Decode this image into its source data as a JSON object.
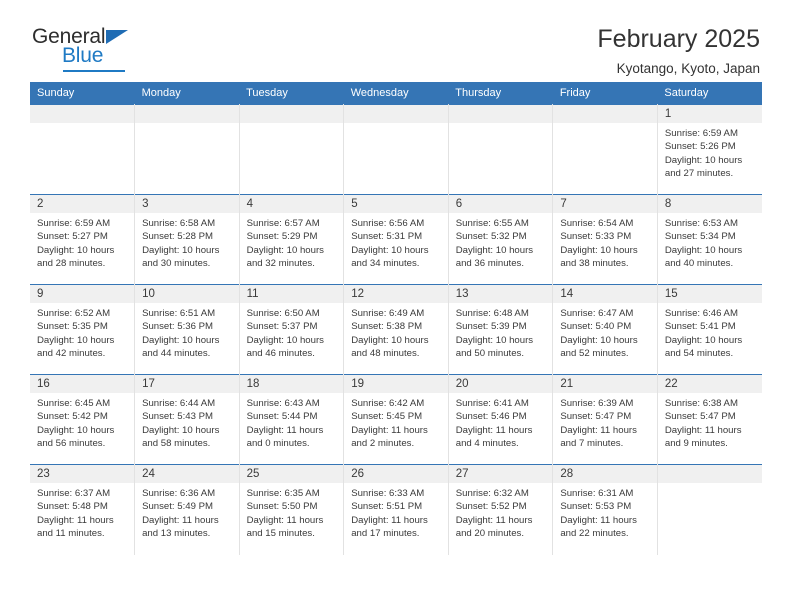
{
  "brand": {
    "name_part1": "General",
    "name_part2": "Blue",
    "triangle_icon": "triangle-icon"
  },
  "header": {
    "title": "February 2025",
    "subtitle": "Kyotango, Kyoto, Japan"
  },
  "colors": {
    "header_blue": "#3575b5",
    "brand_blue": "#1f7ac4",
    "daynum_band": "#f0f0f0",
    "text": "#3a3a3a"
  },
  "weekdays": [
    "Sunday",
    "Monday",
    "Tuesday",
    "Wednesday",
    "Thursday",
    "Friday",
    "Saturday"
  ],
  "labels": {
    "sunrise": "Sunrise:",
    "sunset": "Sunset:",
    "daylight": "Daylight:"
  },
  "weeks": [
    [
      {
        "day": "",
        "sunrise": "",
        "sunset": "",
        "daylight": "",
        "empty": true
      },
      {
        "day": "",
        "sunrise": "",
        "sunset": "",
        "daylight": "",
        "empty": true
      },
      {
        "day": "",
        "sunrise": "",
        "sunset": "",
        "daylight": "",
        "empty": true
      },
      {
        "day": "",
        "sunrise": "",
        "sunset": "",
        "daylight": "",
        "empty": true
      },
      {
        "day": "",
        "sunrise": "",
        "sunset": "",
        "daylight": "",
        "empty": true
      },
      {
        "day": "",
        "sunrise": "",
        "sunset": "",
        "daylight": "",
        "empty": true
      },
      {
        "day": "1",
        "sunrise": "Sunrise: 6:59 AM",
        "sunset": "Sunset: 5:26 PM",
        "daylight": "Daylight: 10 hours and 27 minutes.",
        "empty": false
      }
    ],
    [
      {
        "day": "2",
        "sunrise": "Sunrise: 6:59 AM",
        "sunset": "Sunset: 5:27 PM",
        "daylight": "Daylight: 10 hours and 28 minutes.",
        "empty": false
      },
      {
        "day": "3",
        "sunrise": "Sunrise: 6:58 AM",
        "sunset": "Sunset: 5:28 PM",
        "daylight": "Daylight: 10 hours and 30 minutes.",
        "empty": false
      },
      {
        "day": "4",
        "sunrise": "Sunrise: 6:57 AM",
        "sunset": "Sunset: 5:29 PM",
        "daylight": "Daylight: 10 hours and 32 minutes.",
        "empty": false
      },
      {
        "day": "5",
        "sunrise": "Sunrise: 6:56 AM",
        "sunset": "Sunset: 5:31 PM",
        "daylight": "Daylight: 10 hours and 34 minutes.",
        "empty": false
      },
      {
        "day": "6",
        "sunrise": "Sunrise: 6:55 AM",
        "sunset": "Sunset: 5:32 PM",
        "daylight": "Daylight: 10 hours and 36 minutes.",
        "empty": false
      },
      {
        "day": "7",
        "sunrise": "Sunrise: 6:54 AM",
        "sunset": "Sunset: 5:33 PM",
        "daylight": "Daylight: 10 hours and 38 minutes.",
        "empty": false
      },
      {
        "day": "8",
        "sunrise": "Sunrise: 6:53 AM",
        "sunset": "Sunset: 5:34 PM",
        "daylight": "Daylight: 10 hours and 40 minutes.",
        "empty": false
      }
    ],
    [
      {
        "day": "9",
        "sunrise": "Sunrise: 6:52 AM",
        "sunset": "Sunset: 5:35 PM",
        "daylight": "Daylight: 10 hours and 42 minutes.",
        "empty": false
      },
      {
        "day": "10",
        "sunrise": "Sunrise: 6:51 AM",
        "sunset": "Sunset: 5:36 PM",
        "daylight": "Daylight: 10 hours and 44 minutes.",
        "empty": false
      },
      {
        "day": "11",
        "sunrise": "Sunrise: 6:50 AM",
        "sunset": "Sunset: 5:37 PM",
        "daylight": "Daylight: 10 hours and 46 minutes.",
        "empty": false
      },
      {
        "day": "12",
        "sunrise": "Sunrise: 6:49 AM",
        "sunset": "Sunset: 5:38 PM",
        "daylight": "Daylight: 10 hours and 48 minutes.",
        "empty": false
      },
      {
        "day": "13",
        "sunrise": "Sunrise: 6:48 AM",
        "sunset": "Sunset: 5:39 PM",
        "daylight": "Daylight: 10 hours and 50 minutes.",
        "empty": false
      },
      {
        "day": "14",
        "sunrise": "Sunrise: 6:47 AM",
        "sunset": "Sunset: 5:40 PM",
        "daylight": "Daylight: 10 hours and 52 minutes.",
        "empty": false
      },
      {
        "day": "15",
        "sunrise": "Sunrise: 6:46 AM",
        "sunset": "Sunset: 5:41 PM",
        "daylight": "Daylight: 10 hours and 54 minutes.",
        "empty": false
      }
    ],
    [
      {
        "day": "16",
        "sunrise": "Sunrise: 6:45 AM",
        "sunset": "Sunset: 5:42 PM",
        "daylight": "Daylight: 10 hours and 56 minutes.",
        "empty": false
      },
      {
        "day": "17",
        "sunrise": "Sunrise: 6:44 AM",
        "sunset": "Sunset: 5:43 PM",
        "daylight": "Daylight: 10 hours and 58 minutes.",
        "empty": false
      },
      {
        "day": "18",
        "sunrise": "Sunrise: 6:43 AM",
        "sunset": "Sunset: 5:44 PM",
        "daylight": "Daylight: 11 hours and 0 minutes.",
        "empty": false
      },
      {
        "day": "19",
        "sunrise": "Sunrise: 6:42 AM",
        "sunset": "Sunset: 5:45 PM",
        "daylight": "Daylight: 11 hours and 2 minutes.",
        "empty": false
      },
      {
        "day": "20",
        "sunrise": "Sunrise: 6:41 AM",
        "sunset": "Sunset: 5:46 PM",
        "daylight": "Daylight: 11 hours and 4 minutes.",
        "empty": false
      },
      {
        "day": "21",
        "sunrise": "Sunrise: 6:39 AM",
        "sunset": "Sunset: 5:47 PM",
        "daylight": "Daylight: 11 hours and 7 minutes.",
        "empty": false
      },
      {
        "day": "22",
        "sunrise": "Sunrise: 6:38 AM",
        "sunset": "Sunset: 5:47 PM",
        "daylight": "Daylight: 11 hours and 9 minutes.",
        "empty": false
      }
    ],
    [
      {
        "day": "23",
        "sunrise": "Sunrise: 6:37 AM",
        "sunset": "Sunset: 5:48 PM",
        "daylight": "Daylight: 11 hours and 11 minutes.",
        "empty": false
      },
      {
        "day": "24",
        "sunrise": "Sunrise: 6:36 AM",
        "sunset": "Sunset: 5:49 PM",
        "daylight": "Daylight: 11 hours and 13 minutes.",
        "empty": false
      },
      {
        "day": "25",
        "sunrise": "Sunrise: 6:35 AM",
        "sunset": "Sunset: 5:50 PM",
        "daylight": "Daylight: 11 hours and 15 minutes.",
        "empty": false
      },
      {
        "day": "26",
        "sunrise": "Sunrise: 6:33 AM",
        "sunset": "Sunset: 5:51 PM",
        "daylight": "Daylight: 11 hours and 17 minutes.",
        "empty": false
      },
      {
        "day": "27",
        "sunrise": "Sunrise: 6:32 AM",
        "sunset": "Sunset: 5:52 PM",
        "daylight": "Daylight: 11 hours and 20 minutes.",
        "empty": false
      },
      {
        "day": "28",
        "sunrise": "Sunrise: 6:31 AM",
        "sunset": "Sunset: 5:53 PM",
        "daylight": "Daylight: 11 hours and 22 minutes.",
        "empty": false
      },
      {
        "day": "",
        "sunrise": "",
        "sunset": "",
        "daylight": "",
        "empty": true
      }
    ]
  ]
}
